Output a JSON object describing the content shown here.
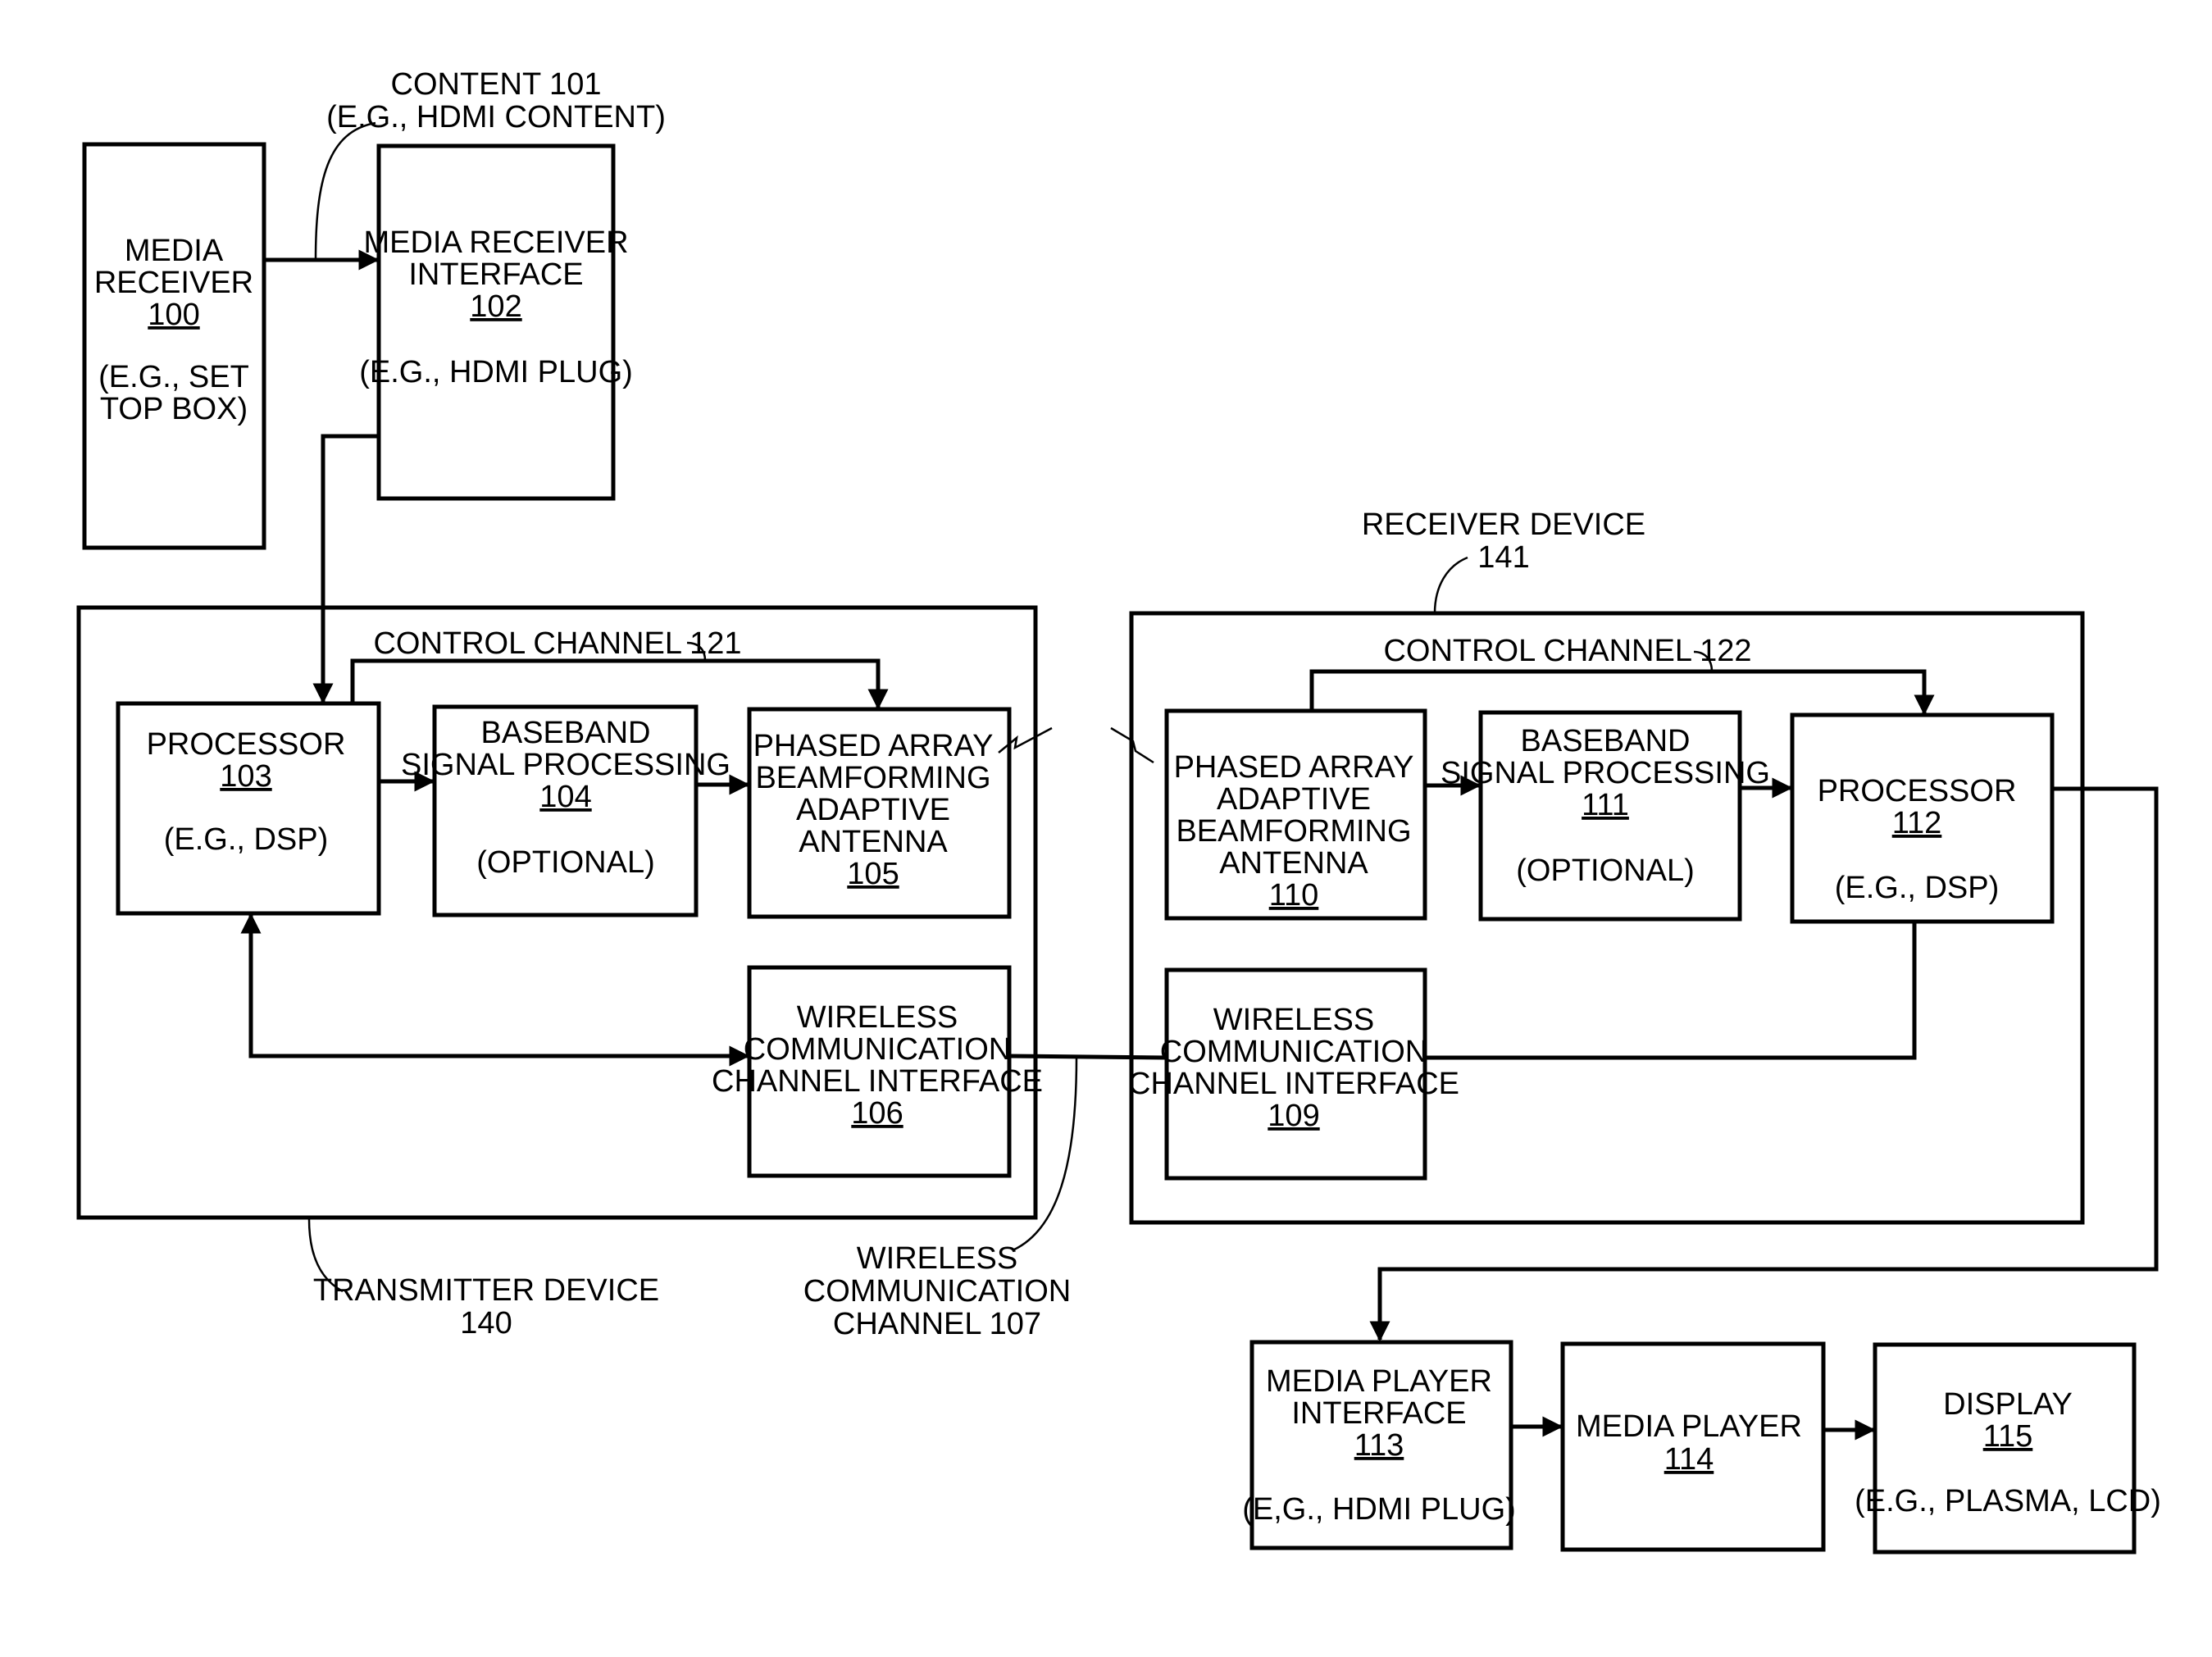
{
  "diagram": {
    "type": "block-diagram",
    "blocks": {
      "media_receiver": {
        "lines": [
          "MEDIA",
          "RECEIVER"
        ],
        "ref": "100",
        "note": [
          "(E.G., SET",
          "TOP BOX)"
        ]
      },
      "media_receiver_interface": {
        "lines": [
          "MEDIA RECEIVER",
          "INTERFACE"
        ],
        "ref": "102",
        "note": [
          "(E.G., HDMI PLUG)"
        ]
      },
      "processor_tx": {
        "lines": [
          "PROCESSOR"
        ],
        "ref": "103",
        "note": [
          "(E.G., DSP)"
        ]
      },
      "baseband_tx": {
        "lines": [
          "BASEBAND",
          "SIGNAL PROCESSING"
        ],
        "ref": "104",
        "note": [
          "(OPTIONAL)"
        ]
      },
      "antenna_tx": {
        "lines": [
          "PHASED ARRAY",
          "BEAMFORMING",
          "ADAPTIVE",
          "ANTENNA"
        ],
        "ref": "105"
      },
      "wccif_tx": {
        "lines": [
          "WIRELESS",
          "COMMUNICATION",
          "CHANNEL INTERFACE"
        ],
        "ref": "106"
      },
      "antenna_rx": {
        "lines": [
          "PHASED ARRAY",
          "ADAPTIVE",
          "BEAMFORMING",
          "ANTENNA"
        ],
        "ref": "110"
      },
      "baseband_rx": {
        "lines": [
          "BASEBAND",
          "SIGNAL PROCESSING"
        ],
        "ref": "111",
        "note": [
          "(OPTIONAL)"
        ]
      },
      "processor_rx": {
        "lines": [
          "PROCESSOR"
        ],
        "ref": "112",
        "note": [
          "(E.G., DSP)"
        ]
      },
      "wccif_rx": {
        "lines": [
          "WIRELESS",
          "COMMUNICATION",
          "CHANNEL INTERFACE"
        ],
        "ref": "109"
      },
      "media_player_interface": {
        "lines": [
          "MEDIA PLAYER",
          "INTERFACE"
        ],
        "ref": "113",
        "note": [
          "(E,G., HDMI PLUG)"
        ]
      },
      "media_player": {
        "lines": [
          "MEDIA PLAYER"
        ],
        "ref": "114"
      },
      "display": {
        "lines": [
          "DISPLAY"
        ],
        "ref": "115",
        "note": [
          "(E.G., PLASMA, LCD)"
        ]
      }
    },
    "labels": {
      "content": [
        "CONTENT 101",
        "(E.G., HDMI CONTENT)"
      ],
      "control_channel_tx": "CONTROL CHANNEL 121",
      "control_channel_rx": "CONTROL CHANNEL 122",
      "receiver_device": [
        "RECEIVER DEVICE",
        "141"
      ],
      "transmitter_device": [
        "TRANSMITTER DEVICE",
        "140"
      ],
      "wireless_channel": [
        "WIRELESS",
        "COMMUNICATION",
        "CHANNEL 107"
      ]
    }
  }
}
